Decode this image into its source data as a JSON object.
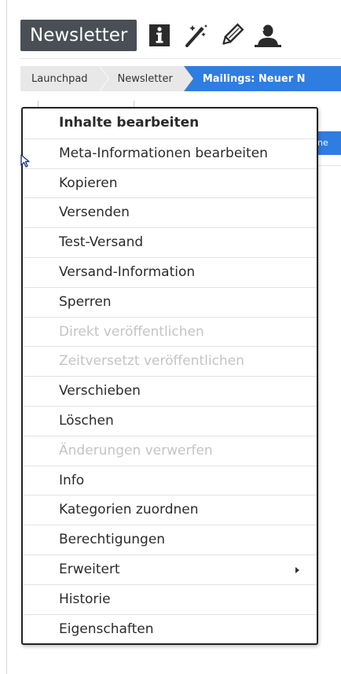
{
  "header": {
    "app_title": "Newsletter",
    "icons": [
      "info-icon",
      "magic-wand-icon",
      "pencil-icon",
      "user-icon"
    ]
  },
  "breadcrumb": {
    "items": [
      "Launchpad",
      "Newsletter",
      "Mailings: Neuer N"
    ]
  },
  "background": {
    "peek_text": "ne"
  },
  "context_menu": {
    "items": [
      {
        "label": "Inhalte bearbeiten",
        "bold": true,
        "disabled": false
      },
      {
        "label": "Meta-Informationen bearbeiten",
        "bold": false,
        "disabled": false
      },
      {
        "label": "Kopieren",
        "bold": false,
        "disabled": false
      },
      {
        "label": "Versenden",
        "bold": false,
        "disabled": false
      },
      {
        "label": "Test-Versand",
        "bold": false,
        "disabled": false
      },
      {
        "label": "Versand-Information",
        "bold": false,
        "disabled": false
      },
      {
        "label": "Sperren",
        "bold": false,
        "disabled": false
      },
      {
        "label": "Direkt veröffentlichen",
        "bold": false,
        "disabled": true
      },
      {
        "label": "Zeitversetzt veröffentlichen",
        "bold": false,
        "disabled": true
      },
      {
        "label": "Verschieben",
        "bold": false,
        "disabled": false
      },
      {
        "label": "Löschen",
        "bold": false,
        "disabled": false
      },
      {
        "label": "Änderungen verwerfen",
        "bold": false,
        "disabled": true
      },
      {
        "label": "Info",
        "bold": false,
        "disabled": false
      },
      {
        "label": "Kategorien zuordnen",
        "bold": false,
        "disabled": false
      },
      {
        "label": "Berechtigungen",
        "bold": false,
        "disabled": false
      },
      {
        "label": "Erweitert",
        "bold": false,
        "disabled": false,
        "submenu": true
      },
      {
        "label": "Historie",
        "bold": false,
        "disabled": false
      },
      {
        "label": "Eigenschaften",
        "bold": false,
        "disabled": false
      }
    ]
  },
  "colors": {
    "title_bg": "#4a4f55",
    "breadcrumb_active": "#2f7de1",
    "disabled_text": "#c4c4c4"
  }
}
